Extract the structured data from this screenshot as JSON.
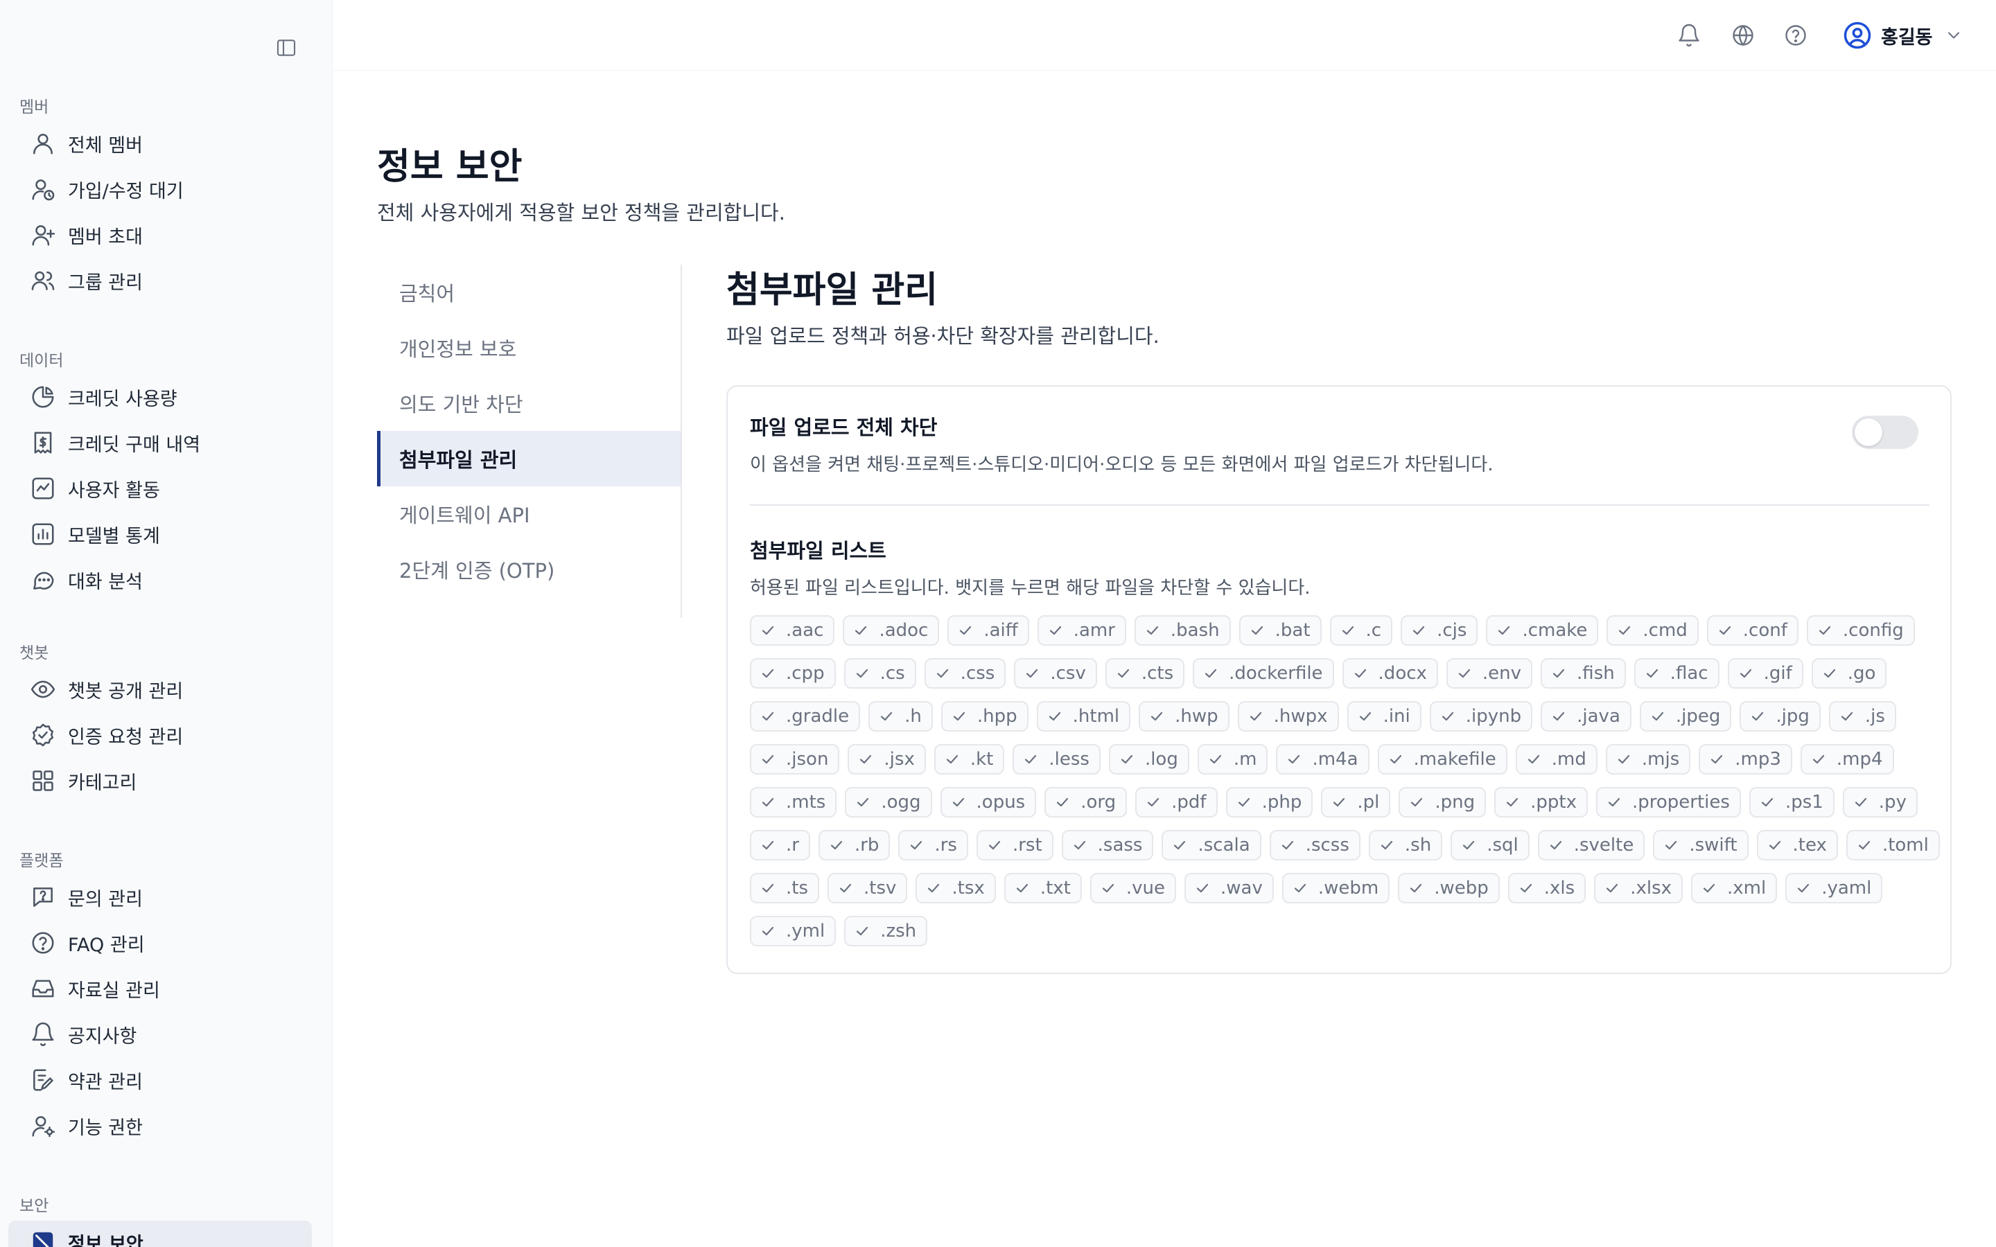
{
  "sidebar": {
    "sections": [
      {
        "title": "멤버",
        "items": [
          {
            "label": "전체 멤버",
            "icon": "user-icon"
          },
          {
            "label": "가입/수정 대기",
            "icon": "user-clock-icon"
          },
          {
            "label": "멤버 초대",
            "icon": "user-plus-icon"
          },
          {
            "label": "그룹 관리",
            "icon": "users-icon"
          }
        ]
      },
      {
        "title": "데이터",
        "items": [
          {
            "label": "크레딧 사용량",
            "icon": "pie-chart-icon"
          },
          {
            "label": "크레딧 구매 내역",
            "icon": "receipt-dollar-icon"
          },
          {
            "label": "사용자 활동",
            "icon": "activity-icon"
          },
          {
            "label": "모델별 통계",
            "icon": "bar-chart-icon"
          },
          {
            "label": "대화 분석",
            "icon": "chat-analysis-icon"
          }
        ]
      },
      {
        "title": "챗봇",
        "items": [
          {
            "label": "챗봇 공개 관리",
            "icon": "eye-icon"
          },
          {
            "label": "인증 요청 관리",
            "icon": "badge-check-icon"
          },
          {
            "label": "카테고리",
            "icon": "grid-icon"
          }
        ]
      },
      {
        "title": "플랫폼",
        "items": [
          {
            "label": "문의 관리",
            "icon": "question-message-icon"
          },
          {
            "label": "FAQ 관리",
            "icon": "help-circle-icon"
          },
          {
            "label": "자료실 관리",
            "icon": "inbox-icon"
          },
          {
            "label": "공지사항",
            "icon": "bell-icon"
          },
          {
            "label": "약관 관리",
            "icon": "file-edit-icon"
          },
          {
            "label": "기능 권한",
            "icon": "user-cog-icon"
          }
        ]
      },
      {
        "title": "보안",
        "items": [
          {
            "label": "정보 보안",
            "icon": "shield-off-icon",
            "active": true
          }
        ]
      }
    ]
  },
  "topbar": {
    "user_name": "홍길동"
  },
  "page": {
    "title": "정보 보안",
    "subtitle": "전체 사용자에게 적용할 보안 정책을 관리합니다."
  },
  "subnav": [
    {
      "label": "금칙어"
    },
    {
      "label": "개인정보 보호"
    },
    {
      "label": "의도 기반 차단"
    },
    {
      "label": "첨부파일 관리",
      "active": true
    },
    {
      "label": "게이트웨이 API"
    },
    {
      "label": "2단계 인증 (OTP)"
    }
  ],
  "section": {
    "title": "첨부파일 관리",
    "subtitle": "파일 업로드 정책과 허용·차단 확장자를 관리합니다."
  },
  "upload_block": {
    "title": "파일 업로드 전체 차단",
    "description": "이 옵션을 켜면 채팅·프로젝트·스튜디오·미디어·오디오 등 모든 화면에서 파일 업로드가 차단됩니다.",
    "enabled": false
  },
  "file_list": {
    "title": "첨부파일 리스트",
    "description": "허용된 파일 리스트입니다. 뱃지를 누르면 해당 파일을 차단할 수 있습니다.",
    "extensions": [
      ".aac",
      ".adoc",
      ".aiff",
      ".amr",
      ".bash",
      ".bat",
      ".c",
      ".cjs",
      ".cmake",
      ".cmd",
      ".conf",
      ".config",
      ".cpp",
      ".cs",
      ".css",
      ".csv",
      ".cts",
      ".dockerfile",
      ".docx",
      ".env",
      ".fish",
      ".flac",
      ".gif",
      ".go",
      ".gradle",
      ".h",
      ".hpp",
      ".html",
      ".hwp",
      ".hwpx",
      ".ini",
      ".ipynb",
      ".java",
      ".jpeg",
      ".jpg",
      ".js",
      ".json",
      ".jsx",
      ".kt",
      ".less",
      ".log",
      ".m",
      ".m4a",
      ".makefile",
      ".md",
      ".mjs",
      ".mp3",
      ".mp4",
      ".mts",
      ".ogg",
      ".opus",
      ".org",
      ".pdf",
      ".php",
      ".pl",
      ".png",
      ".pptx",
      ".properties",
      ".ps1",
      ".py",
      ".r",
      ".rb",
      ".rs",
      ".rst",
      ".sass",
      ".scala",
      ".scss",
      ".sh",
      ".sql",
      ".svelte",
      ".swift",
      ".tex",
      ".toml",
      ".ts",
      ".tsv",
      ".tsx",
      ".txt",
      ".vue",
      ".wav",
      ".webm",
      ".webp",
      ".xls",
      ".xlsx",
      ".xml",
      ".yaml",
      ".yml",
      ".zsh"
    ]
  },
  "colors": {
    "accent": "#1e3a8a",
    "avatar": "#1d4ed8",
    "sidebar_bg": "#f9fafb",
    "badge_border": "#e5e7eb"
  }
}
